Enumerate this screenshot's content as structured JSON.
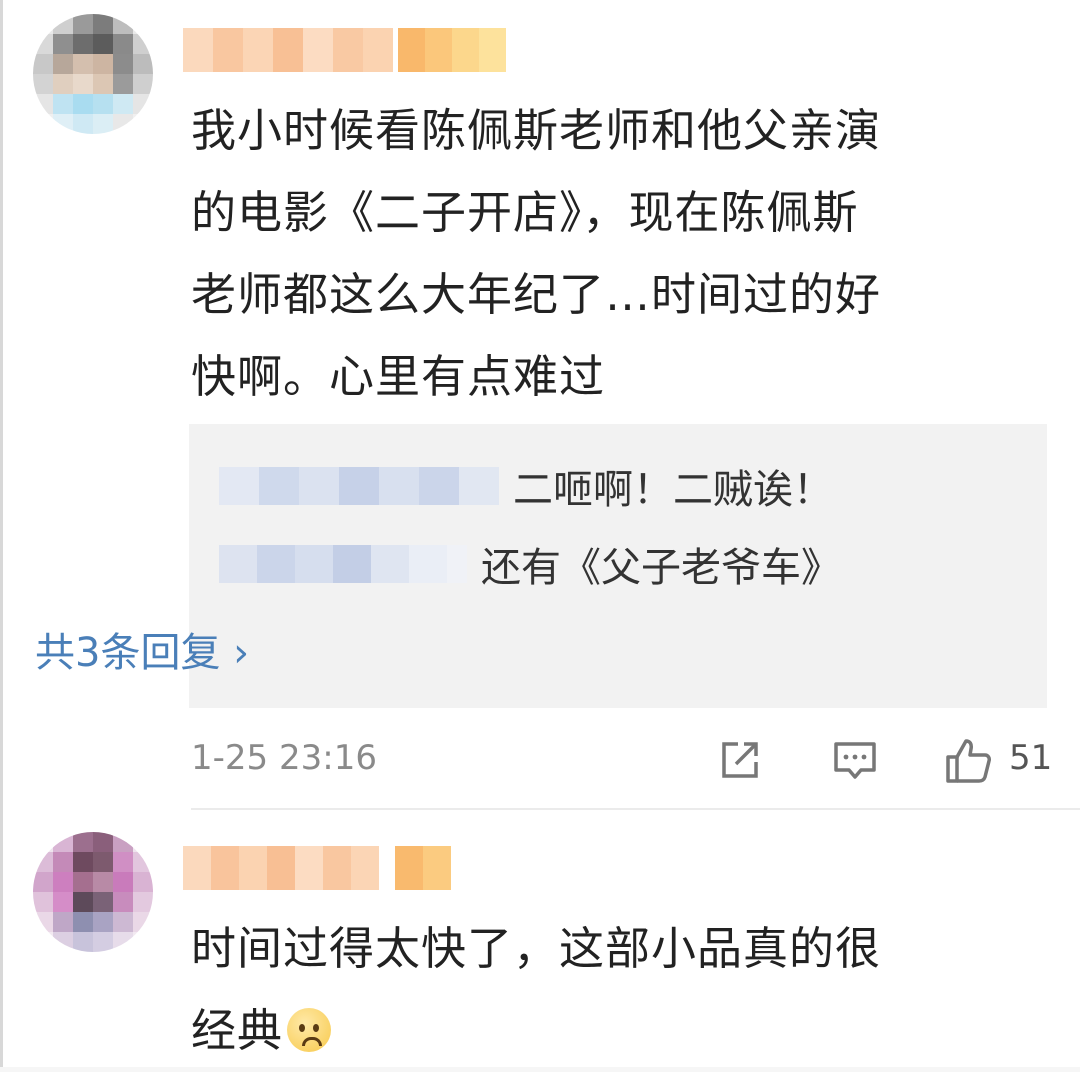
{
  "comments": [
    {
      "text_lines": [
        "我小时候看陈佩斯老师和他父亲演",
        "的电影《二子开店》，现在陈佩斯",
        "老师都这么大年纪了…时间过的好",
        "快啊。心里有点难过"
      ],
      "replies": [
        {
          "text": "二咂啊！二贼诶！"
        },
        {
          "text": "还有《父子老爷车》"
        }
      ],
      "more_replies": "共3条回复 ›",
      "timestamp": "1-25 23:16",
      "likes": "51"
    },
    {
      "text_lines": [
        "时间过得太快了，这部小品真的很",
        "经典"
      ]
    }
  ],
  "icons": {
    "share": "share-icon",
    "comment": "comment-icon",
    "like": "thumbs-up-icon",
    "emoji": "sad-face-emoji-icon"
  },
  "colors": {
    "link": "#4a7fb8",
    "text": "#222222",
    "meta": "#8a8a8a",
    "reply_bg": "#f2f2f2"
  }
}
